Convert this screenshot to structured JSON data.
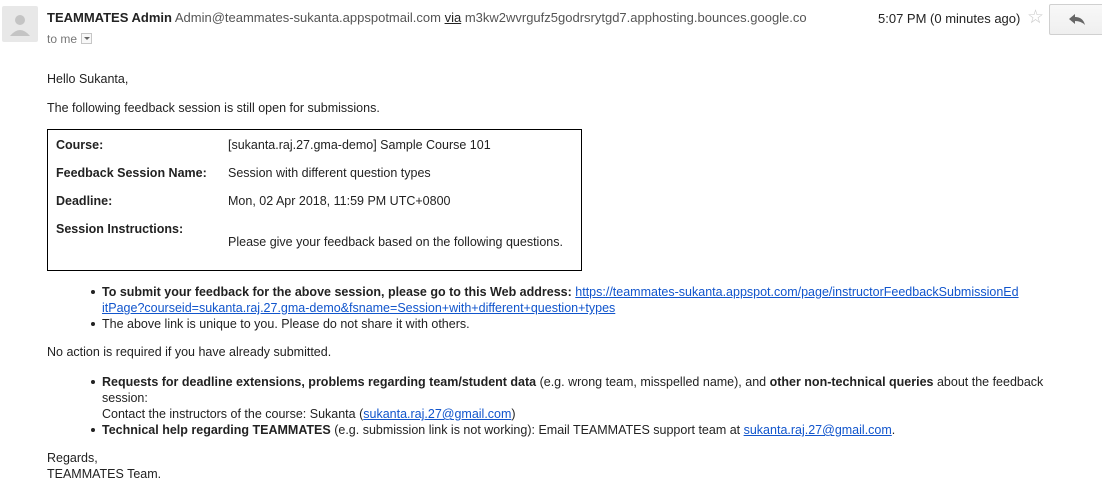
{
  "header": {
    "sender_name": "TEAMMATES Admin",
    "sender_email": "Admin@teammates-sukanta.appspotmail.com",
    "via": "via",
    "bounce": "m3kw2wvrgufz5godrsrytgd7.apphosting.bounces.google.co",
    "to": "to me",
    "time": "5:07 PM (0 minutes ago)"
  },
  "body": {
    "greeting": "Hello Sukanta,",
    "intro": "The following feedback session is still open for submissions.",
    "info": {
      "course_label": "Course:",
      "course_value": "[sukanta.raj.27.gma-demo] Sample Course 101",
      "session_label": "Feedback Session Name:",
      "session_value": "Session with different question types",
      "deadline_label": "Deadline:",
      "deadline_value": "Mon, 02 Apr 2018, 11:59 PM UTC+0800",
      "instructions_label": "Session Instructions:",
      "instructions_value": "Please give your feedback based on the following questions."
    },
    "bullet1_bold": "To submit your feedback for the above session, please go to this Web address:",
    "link_line1": "https://teammates-sukanta.appspot.com/page/instructorFeedbackSubmissionEd",
    "link_line2": "itPage?courseid=sukanta.raj.27.gma-demo&fsname=Session+with+different+question+types",
    "bullet2": "The above link is unique to you. Please do not share it with others.",
    "no_action": "No action is required if you have already submitted.",
    "bullet3_bold1": "Requests for deadline extensions, problems regarding team/student data",
    "bullet3_text1": " (e.g. wrong team, misspelled name), and ",
    "bullet3_bold2": "other non-technical queries",
    "bullet3_text2": " about the feedback",
    "bullet3_line2": "session:",
    "bullet3_contact": "Contact the instructors of the course: Sukanta (",
    "bullet3_email": "sukanta.raj.27@gmail.com",
    "bullet3_close": ")",
    "bullet4_bold": "Technical help regarding TEAMMATES",
    "bullet4_text": " (e.g. submission link is not working): Email TEAMMATES support team at ",
    "bullet4_email": "sukanta.raj.27@gmail.com",
    "bullet4_end": ".",
    "regards": "Regards,",
    "team": "TEAMMATES Team."
  },
  "icons": {
    "avatar": "person-icon",
    "star": "star-icon",
    "reply": "reply-icon",
    "dropdown": "chevron-down-icon"
  }
}
